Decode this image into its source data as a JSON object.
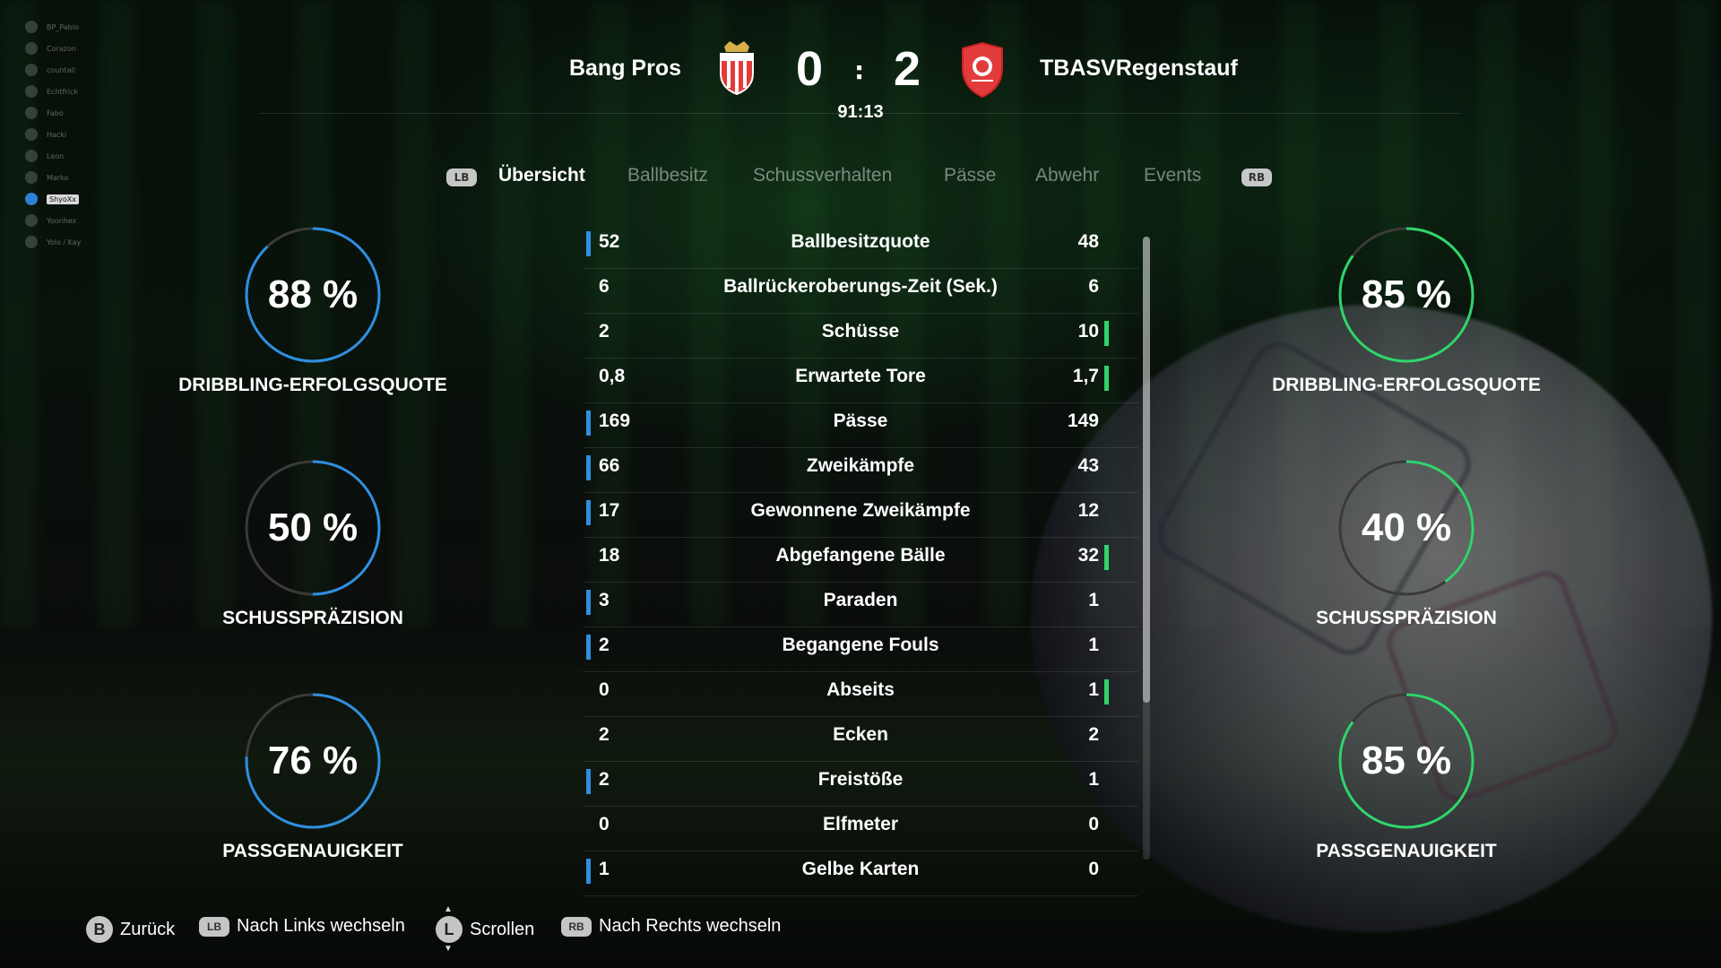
{
  "players": [
    {
      "name": "BP_Pablo"
    },
    {
      "name": "Corazon"
    },
    {
      "name": "countall"
    },
    {
      "name": "Echtfrick"
    },
    {
      "name": "Fabo"
    },
    {
      "name": "Hacki"
    },
    {
      "name": "Leon"
    },
    {
      "name": "Marko"
    },
    {
      "name": "ShyoXx",
      "active": true
    },
    {
      "name": "Yoonhex"
    },
    {
      "name": "Yolo / Kay"
    }
  ],
  "match": {
    "home_team": "Bang Pros",
    "away_team": "TBASVRegenstauf",
    "home_score": "0",
    "away_score": "2",
    "separator": ":",
    "clock": "91:13"
  },
  "tabs": {
    "lb": "LB",
    "rb": "RB",
    "items": [
      "Übersicht",
      "Ballbesitz",
      "Schussverhalten",
      "Pässe",
      "Abwehr",
      "Events"
    ],
    "active": 0
  },
  "home_rings": [
    {
      "value": 88,
      "text": "88 %",
      "label": "DRIBBLING-ERFOLGSQUOTE"
    },
    {
      "value": 50,
      "text": "50 %",
      "label": "SCHUSSPRÄZISION"
    },
    {
      "value": 76,
      "text": "76 %",
      "label": "PASSGENAUIGKEIT"
    }
  ],
  "away_rings": [
    {
      "value": 85,
      "text": "85 %",
      "label": "DRIBBLING-ERFOLGSQUOTE"
    },
    {
      "value": 40,
      "text": "40 %",
      "label": "SCHUSSPRÄZISION"
    },
    {
      "value": 85,
      "text": "85 %",
      "label": "PASSGENAUIGKEIT"
    }
  ],
  "stats": [
    {
      "home": "52",
      "name": "Ballbesitzquote",
      "away": "48",
      "lead": "home"
    },
    {
      "home": "6",
      "name": "Ballrückeroberungs-Zeit (Sek.)",
      "away": "6",
      "lead": "none"
    },
    {
      "home": "2",
      "name": "Schüsse",
      "away": "10",
      "lead": "away"
    },
    {
      "home": "0,8",
      "name": "Erwartete Tore",
      "away": "1,7",
      "lead": "away"
    },
    {
      "home": "169",
      "name": "Pässe",
      "away": "149",
      "lead": "home"
    },
    {
      "home": "66",
      "name": "Zweikämpfe",
      "away": "43",
      "lead": "home"
    },
    {
      "home": "17",
      "name": "Gewonnene Zweikämpfe",
      "away": "12",
      "lead": "home"
    },
    {
      "home": "18",
      "name": "Abgefangene Bälle",
      "away": "32",
      "lead": "away"
    },
    {
      "home": "3",
      "name": "Paraden",
      "away": "1",
      "lead": "home"
    },
    {
      "home": "2",
      "name": "Begangene Fouls",
      "away": "1",
      "lead": "home"
    },
    {
      "home": "0",
      "name": "Abseits",
      "away": "1",
      "lead": "away"
    },
    {
      "home": "2",
      "name": "Ecken",
      "away": "2",
      "lead": "none"
    },
    {
      "home": "2",
      "name": "Freistöße",
      "away": "1",
      "lead": "home"
    },
    {
      "home": "0",
      "name": "Elfmeter",
      "away": "0",
      "lead": "none"
    },
    {
      "home": "1",
      "name": "Gelbe Karten",
      "away": "0",
      "lead": "home"
    }
  ],
  "footer": {
    "back_key": "B",
    "back": "Zurück",
    "left_key": "LB",
    "left": "Nach Links wechseln",
    "scroll_key": "L",
    "scroll": "Scrollen",
    "right_key": "RB",
    "right": "Nach Rechts wechseln"
  },
  "colors": {
    "home_accent": "#2e8fe0",
    "away_accent": "#2fd56b",
    "ring_track": "#3a3a3a"
  }
}
